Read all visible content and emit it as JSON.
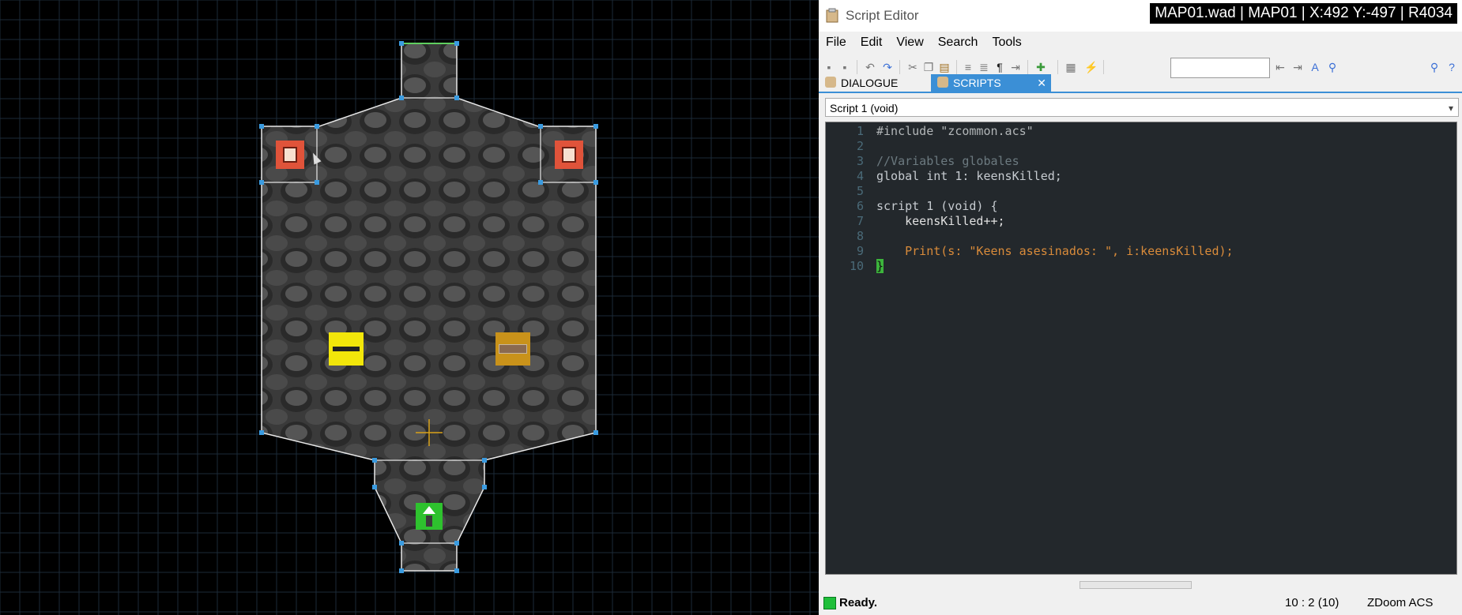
{
  "map_overlay": {
    "info": "MAP01.wad | MAP01 | X:492 Y:-497 | R4034"
  },
  "map_view": {
    "colors": {
      "floor": "#3a3a3a",
      "lines": "#e8e8e8",
      "vertex": "#3a9be0",
      "grid": "#1c2a38"
    },
    "things": [
      {
        "name": "thing-keen-left",
        "icon": "keen-sprite-icon",
        "color": "#e0533a"
      },
      {
        "name": "thing-keen-right",
        "icon": "keen-sprite-icon",
        "color": "#e0533a"
      },
      {
        "name": "thing-weapon-left",
        "icon": "chaingun-icon",
        "color": "#f2e60a"
      },
      {
        "name": "thing-weapon-right",
        "icon": "ammo-box-icon",
        "color": "#c9921a"
      },
      {
        "name": "thing-player-start",
        "icon": "player-start-icon",
        "color": "#2ec22e"
      }
    ]
  },
  "editor": {
    "title": "Script Editor",
    "menu": [
      "File",
      "Edit",
      "View",
      "Search",
      "Tools"
    ],
    "tabs": [
      {
        "label": "DIALOGUE",
        "active": false
      },
      {
        "label": "SCRIPTS",
        "active": true
      }
    ],
    "script_select": "Script 1 (void)",
    "code_lines": [
      {
        "n": "1",
        "text": "#include \"zcommon.acs\""
      },
      {
        "n": "2",
        "text": ""
      },
      {
        "n": "3",
        "text": "//Variables globales"
      },
      {
        "n": "4",
        "text": "global int 1: keensKilled;"
      },
      {
        "n": "5",
        "text": ""
      },
      {
        "n": "6",
        "text": "script 1 (void) {"
      },
      {
        "n": "7",
        "text": "    keensKilled++;"
      },
      {
        "n": "8",
        "text": ""
      },
      {
        "n": "9",
        "text": "    Print(s: \"Keens asesinados: \", i:keensKilled);"
      },
      {
        "n": "10",
        "text": "}"
      }
    ],
    "status": {
      "ready": "Ready.",
      "position": "10 : 2 (10)",
      "language": "ZDoom ACS"
    }
  }
}
